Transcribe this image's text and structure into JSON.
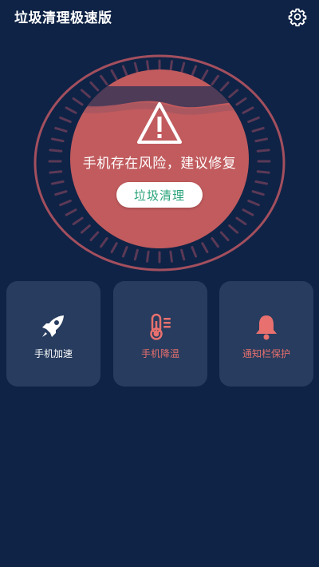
{
  "header": {
    "title": "垃圾清理极速版",
    "settings_icon": "gear-icon"
  },
  "status": {
    "message": "手机存在风险，建议修复",
    "warning_icon": "warning-triangle-icon",
    "state": "risk"
  },
  "actions": {
    "clean_label": "垃圾清理"
  },
  "features": [
    {
      "label": "手机加速",
      "icon": "rocket-icon"
    },
    {
      "label": "手机降温",
      "icon": "thermometer-icon"
    },
    {
      "label": "通知栏保护",
      "icon": "bell-icon"
    }
  ],
  "colors": {
    "background": "#0f2346",
    "card": "#273c5e",
    "danger": "#c15b5e",
    "ring": "#a34f5e",
    "accent_text": "#2aa37a",
    "warn_text": "#e8706e"
  }
}
